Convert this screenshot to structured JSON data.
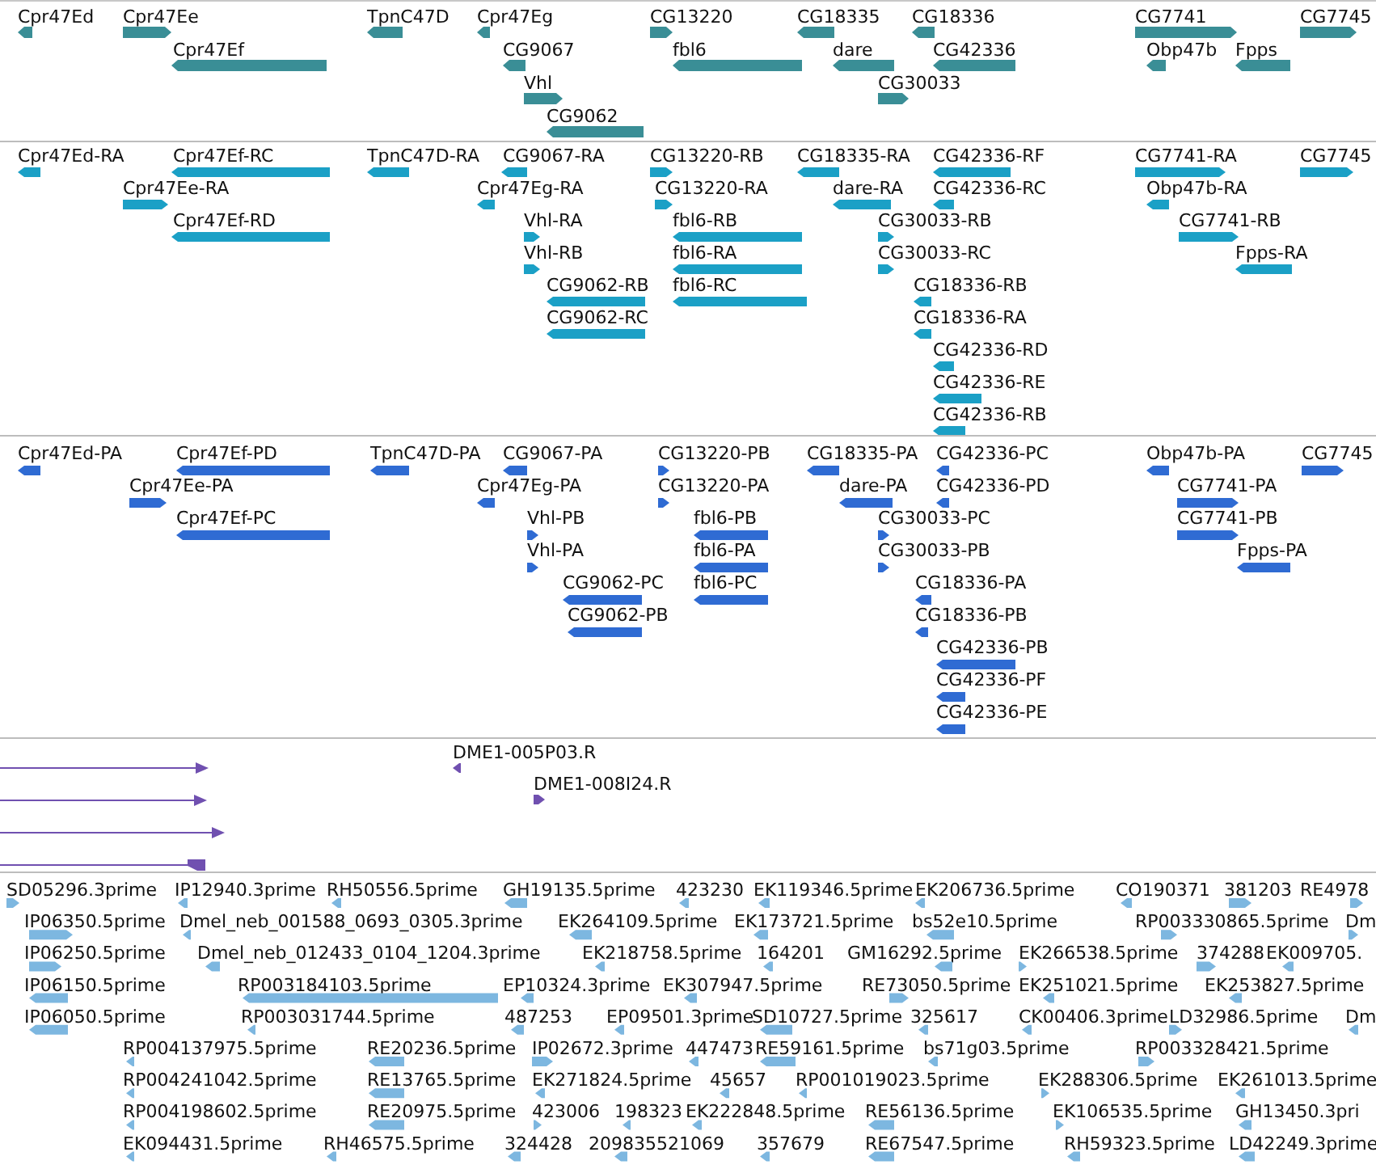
{
  "tracks": [
    {
      "kind": "gene",
      "lanes": [
        [
          {
            "label": "Cpr47Ed",
            "reverse": true
          },
          {
            "label": "Cpr47Ee",
            "reverse": false
          },
          {
            "label": "TpnC47D",
            "reverse": true
          },
          {
            "label": "Cpr47Eg",
            "reverse": true
          },
          {
            "label": "CG13220",
            "reverse": false
          },
          {
            "label": "CG18335",
            "reverse": true
          },
          {
            "label": "CG18336",
            "reverse": true
          },
          {
            "label": "CG7741",
            "reverse": false
          },
          {
            "label": "CG7745",
            "reverse": false
          }
        ],
        [
          {
            "label": "Cpr47Ef",
            "reverse": true
          },
          {
            "label": "CG9067",
            "reverse": true
          },
          {
            "label": "fbl6",
            "reverse": true
          },
          {
            "label": "dare",
            "reverse": true
          },
          {
            "label": "CG42336",
            "reverse": true
          },
          {
            "label": "Obp47b",
            "reverse": true
          },
          {
            "label": "Fpps",
            "reverse": true
          }
        ],
        [
          {
            "label": "Vhl",
            "reverse": false
          },
          {
            "label": "CG30033",
            "reverse": false
          }
        ],
        [
          {
            "label": "CG9062",
            "reverse": true
          }
        ]
      ]
    },
    {
      "kind": "transcript",
      "lanes": [
        [
          {
            "label": "Cpr47Ed-RA",
            "reverse": true
          },
          {
            "label": "Cpr47Ef-RC",
            "reverse": true
          },
          {
            "label": "TpnC47D-RA",
            "reverse": true
          },
          {
            "label": "CG9067-RA",
            "reverse": true
          },
          {
            "label": "CG13220-RB",
            "reverse": false
          },
          {
            "label": "CG18335-RA",
            "reverse": true
          },
          {
            "label": "CG42336-RF",
            "reverse": true
          },
          {
            "label": "CG7741-RA",
            "reverse": false
          },
          {
            "label": "CG7745",
            "reverse": false
          }
        ],
        [
          {
            "label": "Cpr47Ee-RA",
            "reverse": false
          },
          {
            "label": "Cpr47Eg-RA",
            "reverse": true
          },
          {
            "label": "CG13220-RA",
            "reverse": false
          },
          {
            "label": "dare-RA",
            "reverse": true
          },
          {
            "label": "CG42336-RC",
            "reverse": true
          },
          {
            "label": "Obp47b-RA",
            "reverse": true
          }
        ],
        [
          {
            "label": "Cpr47Ef-RD",
            "reverse": true
          },
          {
            "label": "Vhl-RA",
            "reverse": false
          },
          {
            "label": "fbl6-RB",
            "reverse": true
          },
          {
            "label": "CG30033-RB",
            "reverse": false
          },
          {
            "label": "CG7741-RB",
            "reverse": false
          }
        ],
        [
          {
            "label": "Vhl-RB",
            "reverse": false
          },
          {
            "label": "fbl6-RA",
            "reverse": true
          },
          {
            "label": "CG30033-RC",
            "reverse": false
          },
          {
            "label": "Fpps-RA",
            "reverse": true
          }
        ],
        [
          {
            "label": "CG9062-RB",
            "reverse": true
          },
          {
            "label": "fbl6-RC",
            "reverse": true
          },
          {
            "label": "CG18336-RB",
            "reverse": true
          }
        ],
        [
          {
            "label": "CG9062-RC",
            "reverse": true
          },
          {
            "label": "CG18336-RA",
            "reverse": true
          }
        ],
        [
          {
            "label": "CG42336-RD",
            "reverse": true
          }
        ],
        [
          {
            "label": "CG42336-RE",
            "reverse": true
          }
        ],
        [
          {
            "label": "CG42336-RB",
            "reverse": true
          }
        ]
      ]
    },
    {
      "kind": "protein",
      "lanes": [
        [
          {
            "label": "Cpr47Ed-PA",
            "reverse": true
          },
          {
            "label": "Cpr47Ef-PD",
            "reverse": true
          },
          {
            "label": "TpnC47D-PA",
            "reverse": true
          },
          {
            "label": "CG9067-PA",
            "reverse": true
          },
          {
            "label": "CG13220-PB",
            "reverse": false
          },
          {
            "label": "CG18335-PA",
            "reverse": true
          },
          {
            "label": "CG42336-PC",
            "reverse": true
          },
          {
            "label": "Obp47b-PA",
            "reverse": true
          },
          {
            "label": "CG7745",
            "reverse": false
          }
        ],
        [
          {
            "label": "Cpr47Ee-PA",
            "reverse": false
          },
          {
            "label": "Cpr47Eg-PA",
            "reverse": true
          },
          {
            "label": "CG13220-PA",
            "reverse": false
          },
          {
            "label": "dare-PA",
            "reverse": true
          },
          {
            "label": "CG42336-PD",
            "reverse": true
          },
          {
            "label": "CG7741-PA",
            "reverse": false
          }
        ],
        [
          {
            "label": "Cpr47Ef-PC",
            "reverse": true
          },
          {
            "label": "Vhl-PB",
            "reverse": false
          },
          {
            "label": "fbl6-PB",
            "reverse": true
          },
          {
            "label": "CG30033-PC",
            "reverse": false
          },
          {
            "label": "CG7741-PB",
            "reverse": false
          }
        ],
        [
          {
            "label": "Vhl-PA",
            "reverse": false
          },
          {
            "label": "fbl6-PA",
            "reverse": true
          },
          {
            "label": "CG30033-PB",
            "reverse": false
          },
          {
            "label": "Fpps-PA",
            "reverse": true
          }
        ],
        [
          {
            "label": "CG9062-PC",
            "reverse": true
          },
          {
            "label": "fbl6-PC",
            "reverse": true
          },
          {
            "label": "CG18336-PA",
            "reverse": true
          }
        ],
        [
          {
            "label": "CG9062-PB",
            "reverse": true
          },
          {
            "label": "CG18336-PB",
            "reverse": true
          }
        ],
        [
          {
            "label": "CG42336-PB",
            "reverse": true
          }
        ],
        [
          {
            "label": "CG42336-PF",
            "reverse": true
          }
        ],
        [
          {
            "label": "CG42336-PE",
            "reverse": true
          }
        ]
      ]
    },
    {
      "kind": "read",
      "lines": [
        {
          "reverse": false
        },
        {
          "reverse": false
        },
        {
          "reverse": false
        },
        {
          "reverse": true
        }
      ],
      "lanes": [
        [
          {
            "label": "DME1-005P03.R",
            "reverse": true
          }
        ],
        [
          {
            "label": "DME1-008I24.R",
            "reverse": false
          }
        ]
      ]
    },
    {
      "kind": "est",
      "lanes": [
        [
          {
            "label": "SD05296.3prime",
            "reverse": false
          },
          {
            "label": "IP12940.3prime",
            "reverse": true
          },
          {
            "label": "RH50556.5prime",
            "reverse": true
          },
          {
            "label": "GH19135.5prime",
            "reverse": true
          },
          {
            "label": "423230",
            "reverse": true
          },
          {
            "label": "EK119346.5prime",
            "reverse": true
          },
          {
            "label": "EK206736.5prime",
            "reverse": true
          },
          {
            "label": "CO190371",
            "reverse": true
          },
          {
            "label": "381203",
            "reverse": false
          },
          {
            "label": "RE4978",
            "reverse": false
          }
        ],
        [
          {
            "label": "IP06350.5prime",
            "reverse": false
          },
          {
            "label": "Dmel_neb_001588_0693_0305.3prime",
            "reverse": true
          },
          {
            "label": "EK264109.5prime",
            "reverse": true
          },
          {
            "label": "EK173721.5prime",
            "reverse": true
          },
          {
            "label": "bs52e10.5prime",
            "reverse": true
          },
          {
            "label": "RP003330865.5prime",
            "reverse": false
          },
          {
            "label": "Dm",
            "reverse": false
          }
        ],
        [
          {
            "label": "IP06250.5prime",
            "reverse": false
          },
          {
            "label": "Dmel_neb_012433_0104_1204.3prime",
            "reverse": true
          },
          {
            "label": "EK218758.5prime",
            "reverse": true
          },
          {
            "label": "164201",
            "reverse": true
          },
          {
            "label": "GM16292.5prime",
            "reverse": true
          },
          {
            "label": "EK266538.5prime",
            "reverse": false
          },
          {
            "label": "374288",
            "reverse": false
          },
          {
            "label": "EK009705.",
            "reverse": true
          }
        ],
        [
          {
            "label": "IP06150.5prime",
            "reverse": true
          },
          {
            "label": "RP003184103.5prime",
            "reverse": true
          },
          {
            "label": "EP10324.3prime",
            "reverse": true
          },
          {
            "label": "EK307947.5prime",
            "reverse": true
          },
          {
            "label": "RE73050.5prime",
            "reverse": false
          },
          {
            "label": "EK251021.5prime",
            "reverse": true
          },
          {
            "label": "EK253827.5prime",
            "reverse": true
          }
        ],
        [
          {
            "label": "IP06050.5prime",
            "reverse": true
          },
          {
            "label": "RP003031744.5prime",
            "reverse": true
          },
          {
            "label": "487253",
            "reverse": true
          },
          {
            "label": "EP09501.3prime",
            "reverse": true
          },
          {
            "label": "SD10727.5prime",
            "reverse": true
          },
          {
            "label": "325617",
            "reverse": true
          },
          {
            "label": "CK00406.3prime",
            "reverse": true
          },
          {
            "label": "LD32986.5prime",
            "reverse": false
          },
          {
            "label": "Dm",
            "reverse": true
          }
        ],
        [
          {
            "label": "RP004137975.5prime",
            "reverse": true
          },
          {
            "label": "RE20236.5prime",
            "reverse": true
          },
          {
            "label": "IP02672.3prime",
            "reverse": false
          },
          {
            "label": "447473",
            "reverse": true
          },
          {
            "label": "RE59161.5prime",
            "reverse": true
          },
          {
            "label": "bs71g03.5prime",
            "reverse": true
          },
          {
            "label": "RP003328421.5prime",
            "reverse": false
          }
        ],
        [
          {
            "label": "RP004241042.5prime",
            "reverse": true
          },
          {
            "label": "RE13765.5prime",
            "reverse": true
          },
          {
            "label": "EK271824.5prime",
            "reverse": true
          },
          {
            "label": "45657",
            "reverse": true
          },
          {
            "label": "RP001019023.5prime",
            "reverse": true
          },
          {
            "label": "EK288306.5prime",
            "reverse": false
          },
          {
            "label": "EK261013.5prime",
            "reverse": true
          }
        ],
        [
          {
            "label": "RP004198602.5prime",
            "reverse": true
          },
          {
            "label": "RE20975.5prime",
            "reverse": true
          },
          {
            "label": "423006",
            "reverse": false
          },
          {
            "label": "198323",
            "reverse": true
          },
          {
            "label": "EK222848.5prime",
            "reverse": true
          },
          {
            "label": "RE56136.5prime",
            "reverse": true
          },
          {
            "label": "EK106535.5prime",
            "reverse": false
          },
          {
            "label": "GH13450.3pri",
            "reverse": true
          }
        ],
        [
          {
            "label": "EK094431.5prime",
            "reverse": true
          },
          {
            "label": "RH46575.5prime",
            "reverse": true
          },
          {
            "label": "324428",
            "reverse": true
          },
          {
            "label": "209835521069",
            "reverse": true
          },
          {
            "label": "357679",
            "reverse": true
          },
          {
            "label": "RE67547.5prime",
            "reverse": true
          },
          {
            "label": "RH59323.5prime",
            "reverse": true
          },
          {
            "label": "LD42249.3prime",
            "reverse": true
          }
        ]
      ]
    }
  ]
}
